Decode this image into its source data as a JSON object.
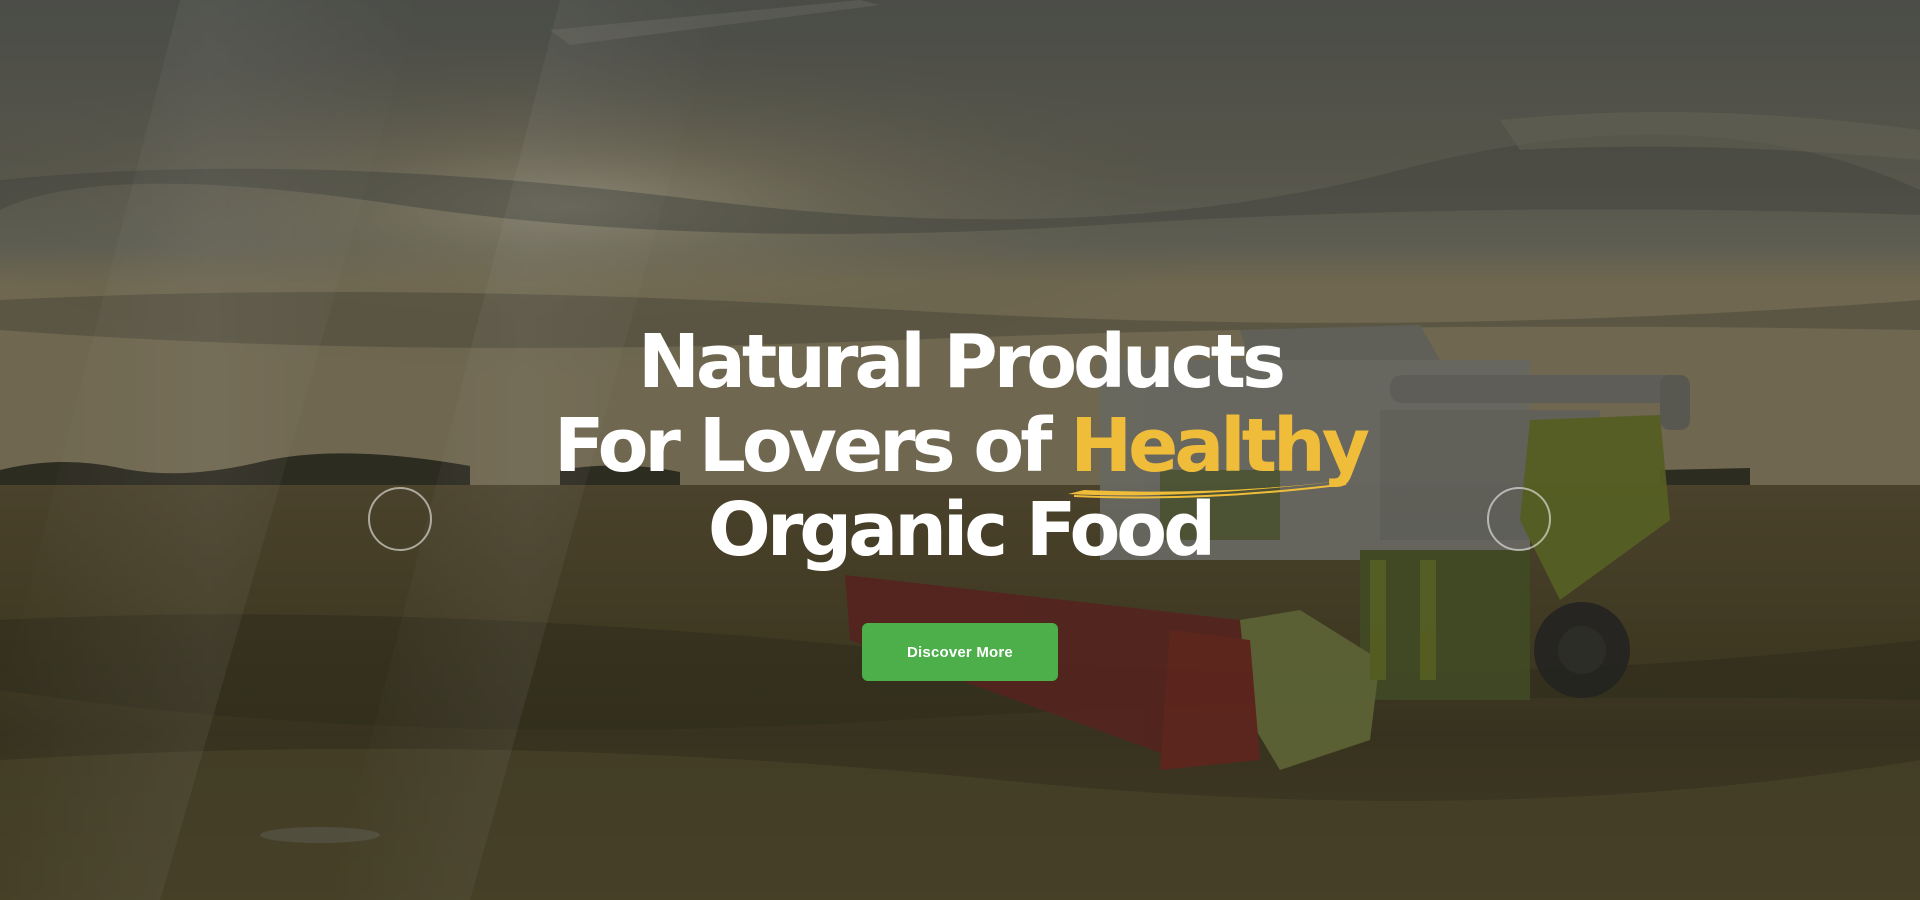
{
  "hero": {
    "headline": {
      "line1": "Natural Products",
      "line2_prefix": "For Lovers of ",
      "line2_highlight": "Healthy",
      "line3": "Organic Food"
    },
    "cta_label": "Discover More"
  },
  "colors": {
    "highlight": "#f0bd3a",
    "cta_background": "#4caf4a",
    "text": "#ffffff"
  },
  "icons": {
    "prev": "slider-prev-circle-icon",
    "next": "slider-next-circle-icon",
    "underline": "brush-underline-icon"
  }
}
